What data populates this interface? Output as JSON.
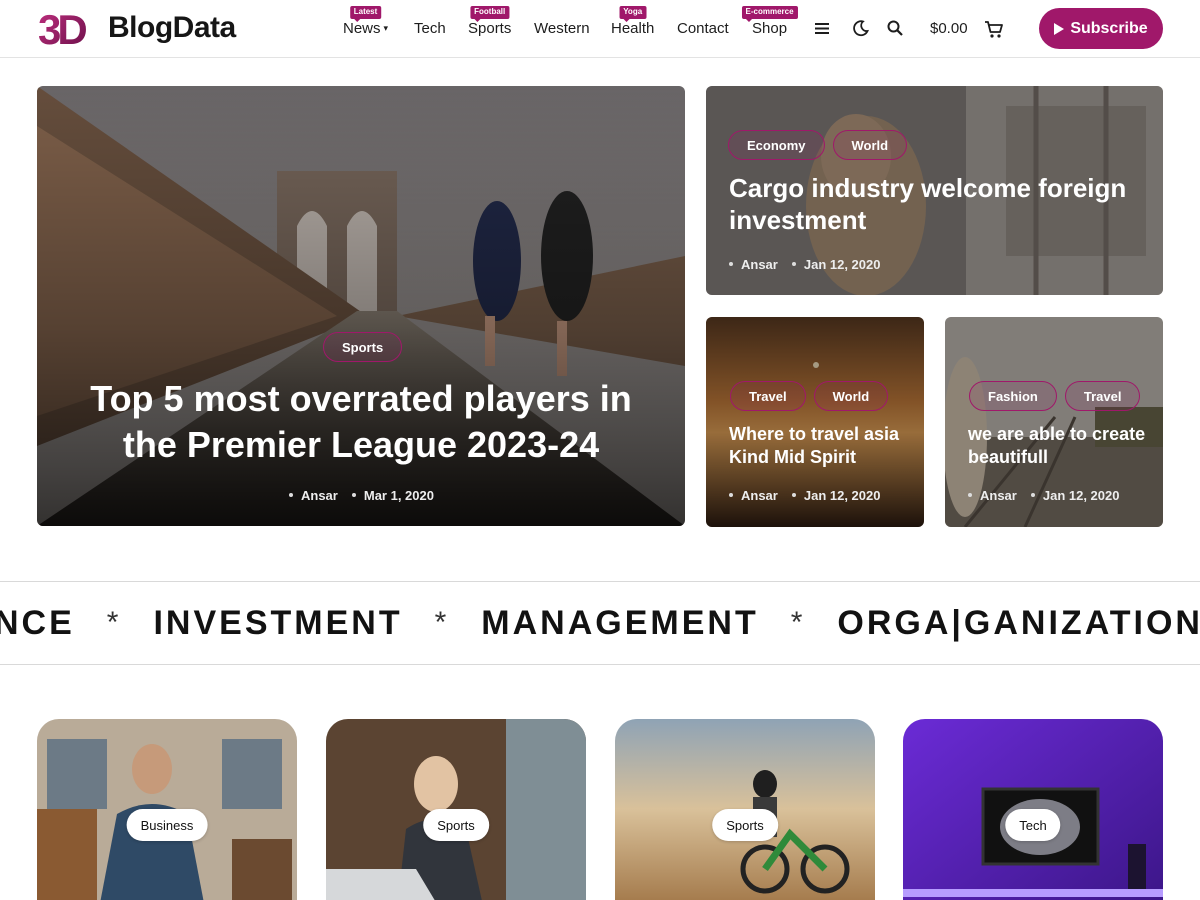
{
  "brand": {
    "logo_mark": "3D",
    "name": "BlogData",
    "accent": "#a0186a"
  },
  "nav": {
    "items": [
      {
        "label": "News",
        "badge": "Latest",
        "has_dropdown": true
      },
      {
        "label": "Tech",
        "badge": ""
      },
      {
        "label": "Sports",
        "badge": "Football"
      },
      {
        "label": "Western",
        "badge": ""
      },
      {
        "label": "Health",
        "badge": "Yoga"
      },
      {
        "label": "Contact",
        "badge": ""
      },
      {
        "label": "Shop",
        "badge": "E-commerce"
      }
    ],
    "icons": [
      "menu-icon",
      "dark-mode-icon",
      "search-icon",
      "cart-icon"
    ],
    "cart_amount": "$0.00",
    "subscribe_label": "Subscribe"
  },
  "hero": {
    "main": {
      "tags": [
        "Sports"
      ],
      "title": "Top 5 most overrated players in the Premier League 2023-24",
      "author": "Ansar",
      "date": "Mar 1, 2020"
    },
    "top_right": {
      "tags": [
        "Economy",
        "World"
      ],
      "title": "Cargo industry welcome foreign investment",
      "author": "Ansar",
      "date": "Jan 12, 2020"
    },
    "bottom_left": {
      "tags": [
        "Travel",
        "World"
      ],
      "title": "Where to travel asia Kind Mid Spirit",
      "author": "Ansar",
      "date": "Jan 12, 2020"
    },
    "bottom_right": {
      "tags": [
        "Fashion",
        "Travel"
      ],
      "title": "we are able to create beautifull",
      "author": "Ansar",
      "date": "Jan 12, 2020"
    }
  },
  "ticker": {
    "words": [
      "NCE",
      "INVESTMENT",
      "MANAGEMENT",
      "ORGA|GANIZATIONS"
    ],
    "separator": "*"
  },
  "category_cards": [
    {
      "label": "Business"
    },
    {
      "label": "Sports"
    },
    {
      "label": "Sports"
    },
    {
      "label": "Tech"
    }
  ]
}
